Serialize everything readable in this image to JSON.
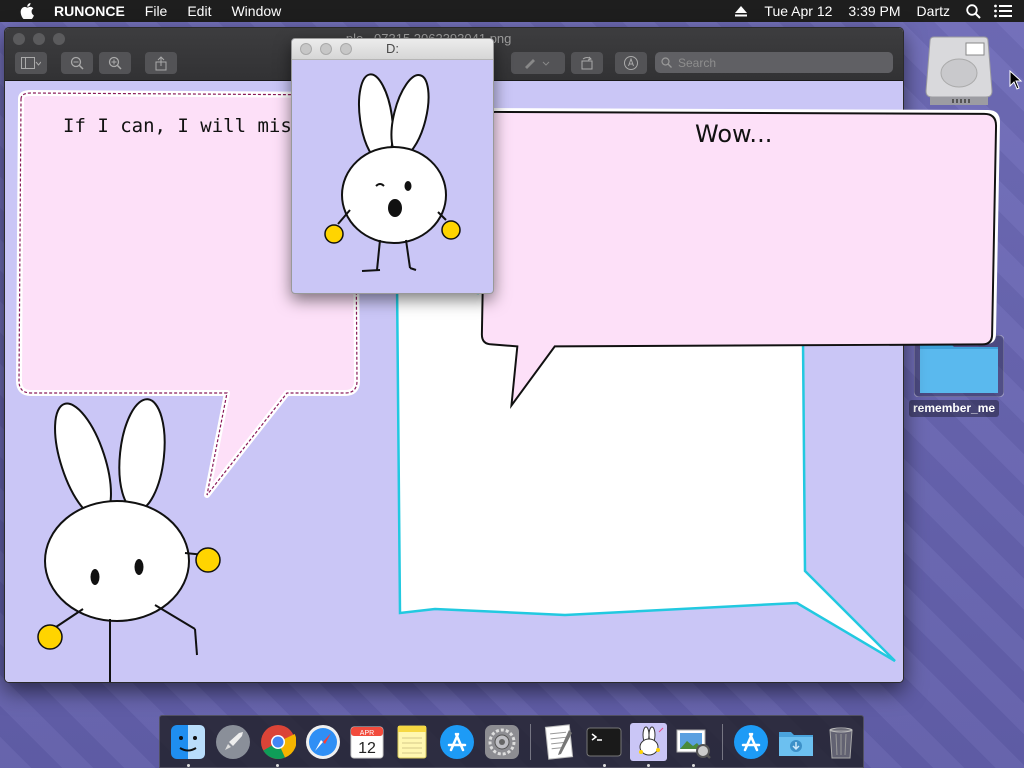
{
  "menubar": {
    "app_name": "RUNONCE",
    "menus": [
      "File",
      "Edit",
      "Window"
    ],
    "date": "Tue Apr 12",
    "time": "3:39 PM",
    "user": "Dartz"
  },
  "preview_window": {
    "title": "...ple...07315 2062393041.png",
    "search_placeholder": "Search",
    "bubble_left_text": "If I can, I will miss yo"
  },
  "small_window": {
    "title": "D:"
  },
  "overlay_bubble": {
    "text": "Wow..."
  },
  "desktop": {
    "folder_label": "remember_me"
  },
  "dock": {
    "items": [
      "finder-icon",
      "launchpad-icon",
      "chrome-icon",
      "safari-icon",
      "calendar-icon",
      "notes-icon",
      "app-store-icon",
      "system-preferences-icon",
      "textedit-icon",
      "terminal-icon",
      "runonce-bunny-icon",
      "preview-icon",
      "app-store-icon",
      "downloads-folder-icon",
      "trash-icon"
    ],
    "calendar_month": "APR",
    "calendar_day": "12"
  },
  "colors": {
    "bubble_pink": "#fde0f8",
    "bg_lavender": "#cac6f6",
    "yellow": "#ffd400",
    "cyan_outline": "#22c9e0"
  }
}
